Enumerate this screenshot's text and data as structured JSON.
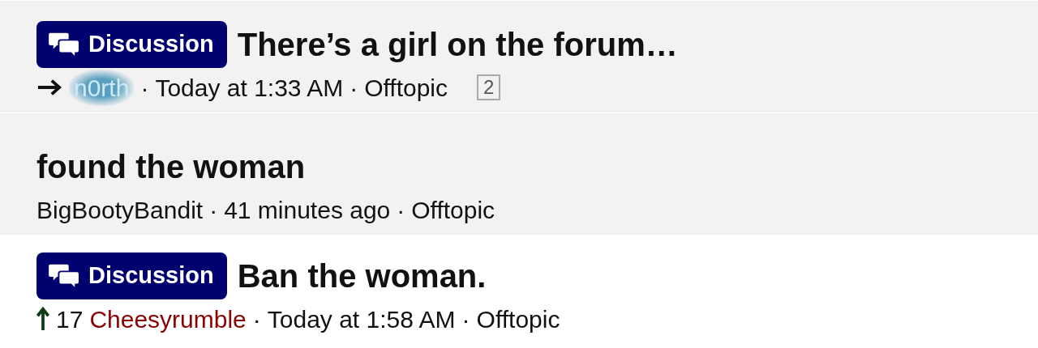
{
  "threads": [
    {
      "highlighted": true,
      "badge": "Discussion",
      "title": "There’s a girl on the forum…",
      "marker": {
        "kind": "arrow"
      },
      "author": {
        "name": "n0rth",
        "kind": "glow"
      },
      "separator_1": "·",
      "time": "Today at 1:33 AM",
      "separator_2": "·",
      "forum": "Offtopic",
      "page_count": "2"
    },
    {
      "highlighted": true,
      "title": "found the woman",
      "author": {
        "name": "BigBootyBandit",
        "kind": "plain"
      },
      "separator_1": "·",
      "time": "41 minutes ago",
      "separator_2": "·",
      "forum": "Offtopic"
    },
    {
      "highlighted": false,
      "badge": "Discussion",
      "title": "Ban the woman.",
      "marker": {
        "kind": "upvote",
        "count": "17"
      },
      "author": {
        "name": "Cheesyrumble",
        "kind": "red"
      },
      "separator_1": "·",
      "time": "Today at 1:58 AM",
      "separator_2": "·",
      "forum": "Offtopic"
    }
  ]
}
